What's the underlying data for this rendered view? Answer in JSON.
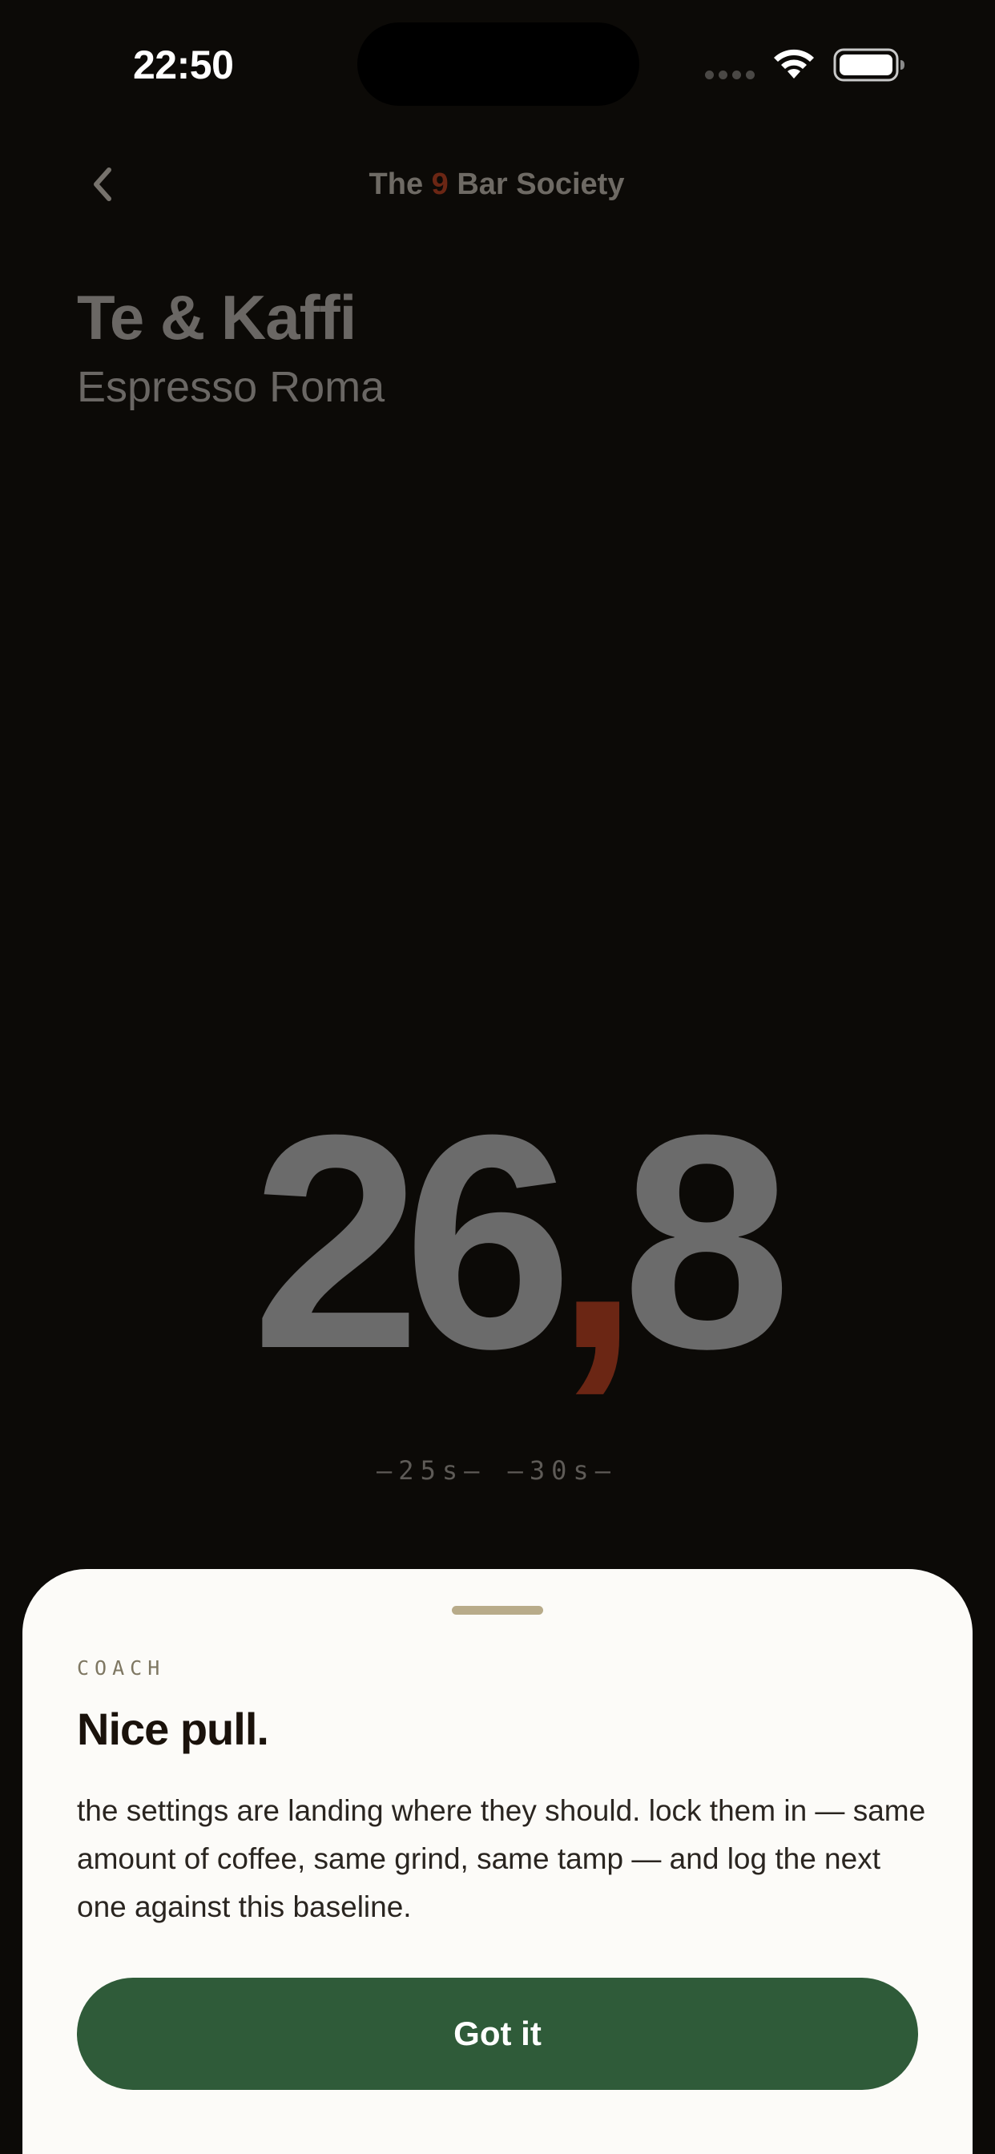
{
  "status_bar": {
    "time": "22:50"
  },
  "nav": {
    "title_prefix": "The ",
    "title_accent": "9",
    "title_suffix": " Bar Society",
    "back_icon": "chevron-left-icon"
  },
  "shot": {
    "cafe": "Te & Kaffi",
    "coffee": "Espresso Roma",
    "weight_whole": "26",
    "weight_comma": ",",
    "weight_decimal": "8",
    "time_range": "–25s– –30s–"
  },
  "coach_sheet": {
    "label": "COACH",
    "title": "Nice pull.",
    "body": "the settings are landing where they should. lock them in — same amount of coffee, same grind, same tamp — and log the next one against this baseline.",
    "button_label": "Got it"
  },
  "colors": {
    "background": "#0c0a07",
    "accent_rust": "#6b2614",
    "button_green": "#2f5b39",
    "sheet": "#fcfbf8"
  }
}
